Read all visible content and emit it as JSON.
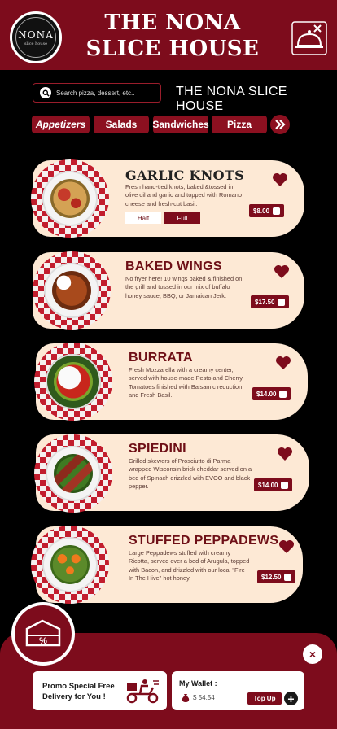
{
  "header": {
    "logo_text": "NONA",
    "logo_sub": "slice house",
    "title": "THE NONA SLICE HOUSE"
  },
  "search": {
    "placeholder": "Search pizza, dessert, etc.."
  },
  "sub_brand": "THE NONA SLICE HOUSE",
  "categories": [
    {
      "label": "Appetizers",
      "active": true
    },
    {
      "label": "Salads"
    },
    {
      "label": "Sandwiches"
    },
    {
      "label": "Pizza"
    }
  ],
  "menu": [
    {
      "name": "GARLIC KNOTS",
      "desc": "Fresh hand-tied knots, baked &tossed in olive oil and garlic and topped with Romano cheese and fresh-cut basil.",
      "price": "$8.00",
      "sizes": [
        "Half",
        "Full"
      ]
    },
    {
      "name": "BAKED WINGS",
      "desc": "No fryer here! 10 wings baked & finished on the grill and tossed in our mix of buffalo honey sauce, BBQ, or Jamaican Jerk.",
      "price": "$17.50"
    },
    {
      "name": "BURRATA",
      "desc": "Fresh Mozzarella with a creamy center, served with house-made Pesto and Cherry Tomatoes finished with Balsamic reduction and Fresh Basil.",
      "price": "$14.00"
    },
    {
      "name": "SPIEDINI",
      "desc": "Grilled skewers of Prosciutto di Parma wrapped Wisconsin brick cheddar served on a bed of Spinach drizzled with EVOO and black pepper.",
      "price": "$14.00"
    },
    {
      "name": "STUFFED PEPPADEWS",
      "desc": "Large Peppadews stuffed with creamy Ricotta, served over a bed of Arugula, topped with Bacon, and drizzled with our local \"Fire In The Hive\" hot honey.",
      "price": "$12.50"
    }
  ],
  "bottom": {
    "promo_line1": "Promo Special Free",
    "promo_line2": "Delivery for You !",
    "wallet_title": "My Wallet :",
    "wallet_amount": "$ 54.54",
    "topup_label": "Top Up",
    "plus_label": "+",
    "close_label": "×"
  },
  "colors": {
    "brand_red": "#7d0c1c",
    "card_bg": "#fde9d5",
    "background": "#000000"
  },
  "icons": [
    "search-icon",
    "cloche-icon",
    "next-arrow-icon",
    "heart-icon",
    "bag-icon",
    "discount-ticket-icon",
    "close-icon",
    "delivery-scooter-icon",
    "money-bag-icon",
    "plus-icon"
  ]
}
